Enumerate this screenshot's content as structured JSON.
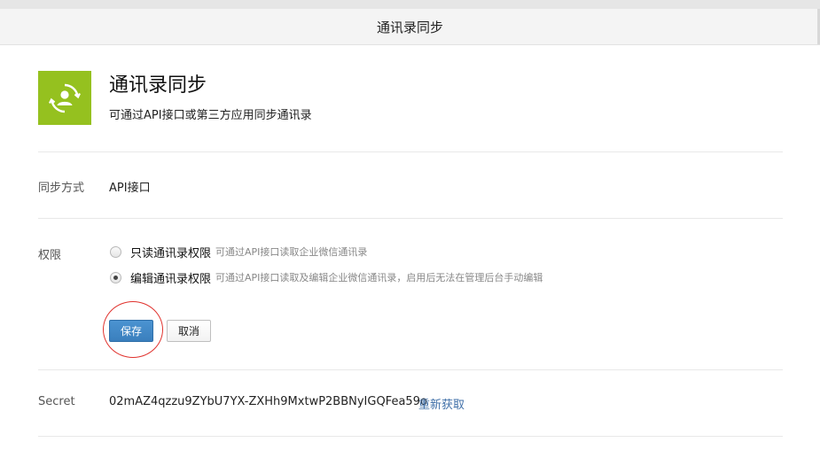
{
  "header": {
    "title": "通讯录同步"
  },
  "app": {
    "title": "通讯录同步",
    "description": "可通过API接口或第三方应用同步通讯录",
    "icon": "contact-sync-icon",
    "icon_bg": "#95c11f"
  },
  "sync_method": {
    "label": "同步方式",
    "value": "API接口"
  },
  "permission": {
    "label": "权限",
    "options": [
      {
        "label": "只读通讯录权限",
        "hint": "可通过API接口读取企业微信通讯录",
        "checked": false
      },
      {
        "label": "编辑通讯录权限",
        "hint": "可通过API接口读取及编辑企业微信通讯录，启用后无法在管理后台手动编辑",
        "checked": true
      }
    ]
  },
  "buttons": {
    "save": "保存",
    "cancel": "取消"
  },
  "secret": {
    "label": "Secret",
    "value": "02mAZ4qzzu9ZYbU7YX-ZXHh9MxtwP2BBNyIGQFea59o",
    "refresh": "重新获取"
  },
  "colors": {
    "accent": "#3a7fbd",
    "link": "#3f6fa8",
    "annotation": "#e0322d"
  }
}
